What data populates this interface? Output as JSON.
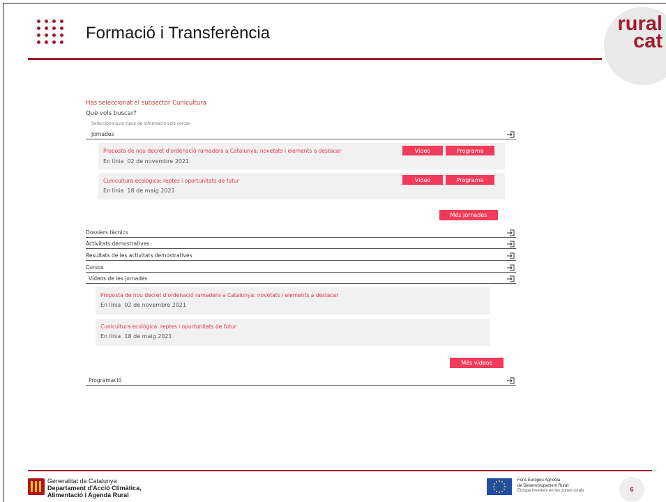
{
  "header": {
    "title": "Formació i Transferència",
    "logo_line1": "rural",
    "logo_line2": "cat",
    "accent_color": "#a01c2c"
  },
  "content": {
    "subsector_text": "Has seleccionat el subsector Cunicultura",
    "question": "Què vols buscar?",
    "hint": "Selecciona quin tipus de informació vols cercar",
    "sections": {
      "jornades": "Jornades",
      "dossiers": "Dossiers tècnics",
      "activitats": "Activitats demostratives",
      "resultats": "Resultats de les activitats demostratives",
      "cursos": "Cursos",
      "videos": "Vídeos de les jornades",
      "programacio": "Programació"
    },
    "jornades_items": [
      {
        "title": "Proposta de nou decret d'ordenació ramadera a Catalunya: novetats i elements a destacar",
        "place": "En línia",
        "date": "02 de novembre 2021",
        "video_label": "Vídeo",
        "programa_label": "Programa"
      },
      {
        "title": "Cunicultura ecològica: reptes i oportunitats de futur",
        "place": "En línia",
        "date": "18 de maig 2021",
        "video_label": "Vídeo",
        "programa_label": "Programa"
      }
    ],
    "mes_jornades": "Més jornades",
    "video_items": [
      {
        "title": "Proposta de nou decret d'ordenació ramadera a Catalunya: novetats i elements a destacar",
        "place": "En línia",
        "date": "02 de novembre 2021"
      },
      {
        "title": "Cunicultura ecològica: reptes i oportunitats de futur",
        "place": "En línia",
        "date": "18 de maig 2021"
      }
    ],
    "mes_videos": "Més vídeos",
    "button_color": "#f03c5a",
    "link_color": "#e8334f",
    "icon": "enter-arrow-icon"
  },
  "footer": {
    "gen_line1": "Generalitat de Catalunya",
    "gen_line2": "Departament d'Acció Climàtica,",
    "gen_line3": "Alimentació i Agenda Rural",
    "fons_line1": "Fons Europeu Agrícola",
    "fons_line2": "de Desenvolupament Rural:",
    "fons_line3": "Europa inverteix en les zones rurals",
    "page_number": "6"
  }
}
